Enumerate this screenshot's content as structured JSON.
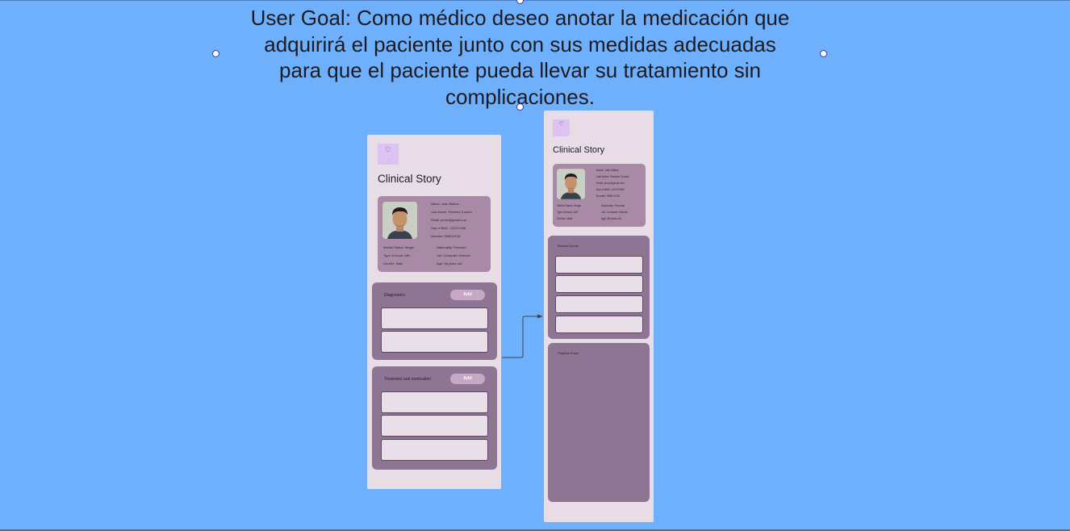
{
  "goal": {
    "line1": "User Goal: Como médico deseo anotar la medicación que",
    "line2": "adquirirá el paciente junto con sus medidas adecuadas",
    "line3": "para que el paciente pueda llevar su tratamiento sin",
    "line4": "complicaciones."
  },
  "screen1": {
    "title": "Clinical Story",
    "patient": {
      "name": "Name: Juan Mattos",
      "last_name": "Last Name: Ramirez Cuardo",
      "email": "Email: jmmc@gmail.com",
      "dob": "Day of Birth: 12/07/1965",
      "number": "Number: 956514728",
      "marital": "Marital Status: Single",
      "nationality": "Nationality: Peruvian",
      "blood": "Type of blood: AB+",
      "job": "Job: Computer Science",
      "gender": "Gender: Male",
      "age": "Age: 58 years old"
    },
    "diagnostics": {
      "label": "Diagnostics",
      "add": "Add"
    },
    "treatment": {
      "label": "Treatment and medication",
      "add": "Add"
    }
  },
  "screen2": {
    "title": "Clinical Story",
    "patient": {
      "name": "Name: Juan Mattos",
      "last_name": "Last Name: Ramirez Cuardo",
      "email": "Email: jmmc@gmail.com",
      "dob": "Day of Birth: 12/07/1965",
      "number": "Number: 956514728",
      "marital": "Marital Status: Single",
      "nationality": "Nationality: Peruvian",
      "blood": "Type of blood: AB+",
      "job": "Job: Computer Science",
      "gender": "Gender: Male",
      "age": "Age: 58 years old"
    },
    "medical_inputs_label": "Medical Inputs",
    "physical_exam_label": "Physical Exam"
  },
  "colors": {
    "background": "#6fb0fd",
    "frame": "#e8dde6",
    "panel": "#8f7594",
    "card": "#a98aa6",
    "logo": "#dcc3f2"
  },
  "icons": [
    "heart-logo-icon",
    "selection-handle",
    "arrow-connector"
  ]
}
